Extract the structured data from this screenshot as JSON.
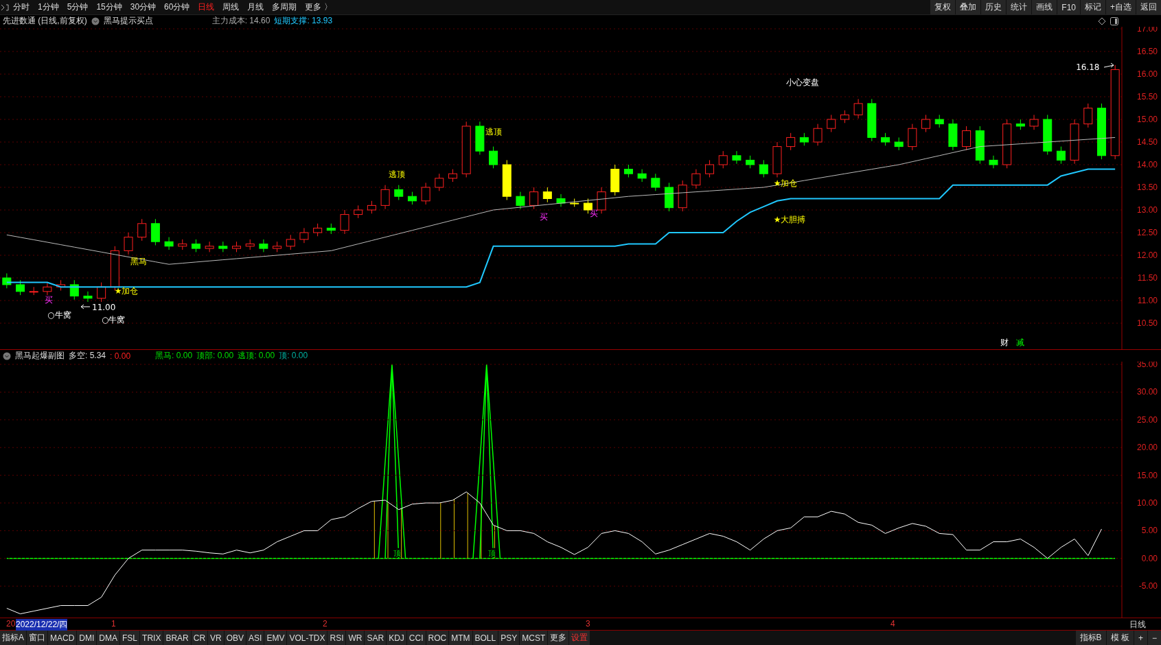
{
  "toolbar": {
    "periods": [
      {
        "label": "分时",
        "selected": false
      },
      {
        "label": "1分钟",
        "selected": false
      },
      {
        "label": "5分钟",
        "selected": false
      },
      {
        "label": "15分钟",
        "selected": false
      },
      {
        "label": "30分钟",
        "selected": false
      },
      {
        "label": "60分钟",
        "selected": false
      },
      {
        "label": "日线",
        "selected": true
      },
      {
        "label": "周线",
        "selected": false
      },
      {
        "label": "月线",
        "selected": false
      },
      {
        "label": "多周期",
        "selected": false
      },
      {
        "label": "更多 〉",
        "selected": false
      }
    ],
    "actions": [
      "复权",
      "叠加",
      "历史",
      "统计",
      "画线",
      "F10",
      "标记",
      "+自选",
      "返回"
    ]
  },
  "main_panel": {
    "title": "先进数通 (日线,前复权)",
    "indicator": "黑马提示买点",
    "cost_label": "主力成本: 14.60",
    "support_label": "短期支撑: 13.93",
    "price_axis": [
      "17.00",
      "16.50",
      "16.00",
      "15.50",
      "15.00",
      "14.50",
      "14.00",
      "13.50",
      "13.00",
      "12.50",
      "12.00",
      "11.50",
      "11.00",
      "10.50"
    ],
    "annotations": [
      {
        "text": "黑马",
        "kind": "signal"
      },
      {
        "text": "★加仓",
        "kind": "signal"
      },
      {
        "text": "11.00",
        "kind": "price"
      },
      {
        "text": "买",
        "kind": "buy"
      },
      {
        "text": "○牛窝",
        "kind": "note"
      },
      {
        "text": "○牛窝",
        "kind": "note"
      },
      {
        "text": "逃顶",
        "kind": "signal"
      },
      {
        "text": "逃顶",
        "kind": "signal"
      },
      {
        "text": "买",
        "kind": "buy"
      },
      {
        "text": "买",
        "kind": "buy"
      },
      {
        "text": "小心变盘",
        "kind": "note"
      },
      {
        "text": "★加仓",
        "kind": "signal"
      },
      {
        "text": "★大胆搏",
        "kind": "signal"
      },
      {
        "text": "16.18",
        "kind": "price"
      },
      {
        "text": "财",
        "kind": "finance"
      },
      {
        "text": "减",
        "kind": "reduce"
      }
    ]
  },
  "sub_panel": {
    "title": "黑马起爆副图",
    "readouts": [
      {
        "text": "多空: 5.34",
        "kind": "neutral"
      },
      {
        "text": ": 0.00",
        "kind": "alert"
      },
      {
        "text": "黑马: 0.00",
        "kind": "signal"
      },
      {
        "text": "顶部: 0.00",
        "kind": "signal"
      },
      {
        "text": "逃顶: 0.00",
        "kind": "signal"
      },
      {
        "text": "顶: 0.00",
        "kind": "muted"
      }
    ],
    "top_marks": [
      "顶",
      "顶"
    ],
    "chart_data": {
      "type": "line",
      "grid": true,
      "ylim": [
        -10.67,
        35.5
      ],
      "series": [
        {
          "color": "#ffffff",
          "values": [
            -9,
            -10,
            -9.5,
            -9,
            -8.5,
            -8.5,
            -8.5,
            -7,
            -3,
            0,
            1.5,
            1.5,
            1.5,
            1.5,
            1.3,
            1,
            0.8,
            1.5,
            1,
            1.5,
            3,
            4,
            5,
            5,
            7,
            7.5,
            9,
            10.3,
            10.5,
            8.8,
            9.8,
            10,
            10,
            10.5,
            12,
            10,
            6,
            5,
            5,
            4.5,
            3,
            2,
            0.7,
            2,
            4.5,
            5,
            4.5,
            3,
            0.8,
            1.5,
            2.5,
            3.5,
            4.5,
            4,
            3,
            1.5,
            3.5,
            5,
            5.5,
            7.5,
            7.5,
            8.5,
            8,
            6.5,
            6,
            4.5,
            5.5,
            6.3,
            5.8,
            4.5,
            4.3,
            1.5,
            1.5,
            3,
            3,
            3.5,
            2,
            0,
            2,
            3.5,
            0.5,
            5.3
          ]
        }
      ],
      "yticks": [
        {
          "value": 35,
          "label": "35.00"
        },
        {
          "value": 30,
          "label": "30.00"
        },
        {
          "value": 25,
          "label": "25.00"
        },
        {
          "value": 20,
          "label": "20.00"
        },
        {
          "value": 15,
          "label": "15.00"
        },
        {
          "value": 10,
          "label": "10.00"
        },
        {
          "value": 5,
          "label": "5.00"
        },
        {
          "value": 0,
          "label": "0.00"
        },
        {
          "value": -5,
          "label": "-5.00"
        }
      ]
    }
  },
  "timeline": {
    "year_prefix": "20",
    "cursor_date": "2022/12/22/四",
    "months": [
      "1",
      "2",
      "3",
      "4"
    ],
    "period": "日线"
  },
  "bottom_bar": {
    "indicators": [
      {
        "label": "指标A",
        "selected": false
      },
      {
        "label": "窗口",
        "selected": false
      },
      {
        "label": "MACD",
        "selected": false
      },
      {
        "label": "DMI",
        "selected": false
      },
      {
        "label": "DMA",
        "selected": false
      },
      {
        "label": "FSL",
        "selected": false
      },
      {
        "label": "TRIX",
        "selected": false
      },
      {
        "label": "BRAR",
        "selected": false
      },
      {
        "label": "CR",
        "selected": false
      },
      {
        "label": "VR",
        "selected": false
      },
      {
        "label": "OBV",
        "selected": false
      },
      {
        "label": "ASI",
        "selected": false
      },
      {
        "label": "EMV",
        "selected": false
      },
      {
        "label": "VOL-TDX",
        "selected": false
      },
      {
        "label": "RSI",
        "selected": false
      },
      {
        "label": "WR",
        "selected": false
      },
      {
        "label": "SAR",
        "selected": false
      },
      {
        "label": "KDJ",
        "selected": false
      },
      {
        "label": "CCI",
        "selected": false
      },
      {
        "label": "ROC",
        "selected": false
      },
      {
        "label": "MTM",
        "selected": false
      },
      {
        "label": "BOLL",
        "selected": false
      },
      {
        "label": "PSY",
        "selected": false
      },
      {
        "label": "MCST",
        "selected": false
      },
      {
        "label": "更多",
        "selected": false
      }
    ],
    "settings": "设置",
    "right_buttons": [
      "指标B",
      "模 板",
      "+",
      "−"
    ]
  }
}
